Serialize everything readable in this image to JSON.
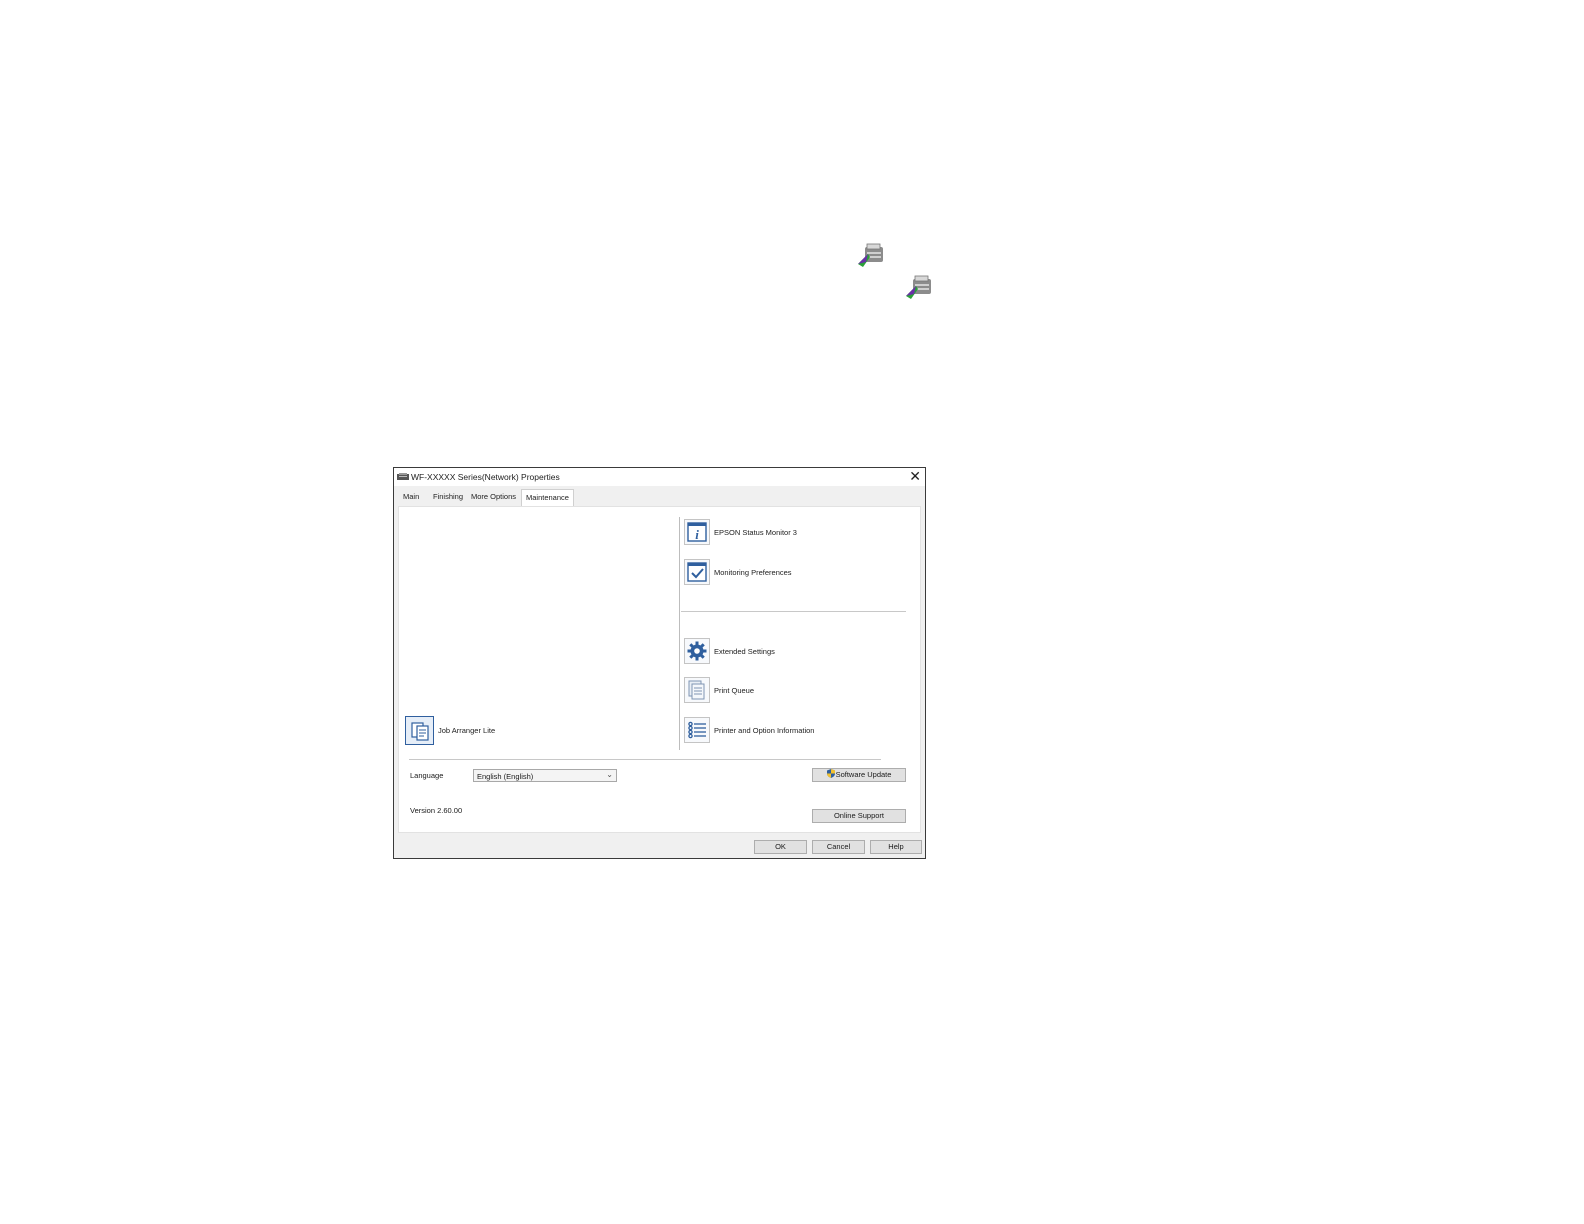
{
  "tray_icons": [
    {
      "name": "printer-driver-icon-1",
      "icon": "printer-arrow-icon"
    },
    {
      "name": "printer-driver-icon-2",
      "icon": "printer-arrow-icon"
    }
  ],
  "dialog": {
    "title": "WF-XXXXX Series(Network) Properties",
    "close_glyph": "✕",
    "tabs": [
      {
        "label": "Main",
        "active": false
      },
      {
        "label": "Finishing",
        "active": false
      },
      {
        "label": "More Options",
        "active": false
      },
      {
        "label": "Maintenance",
        "active": true
      }
    ],
    "left_tools": [
      {
        "label": "Job Arranger Lite",
        "icon": "job-arranger-icon"
      }
    ],
    "right_tools_top": [
      {
        "label": "EPSON Status Monitor 3",
        "icon": "info-icon"
      },
      {
        "label": "Monitoring Preferences",
        "icon": "checkmark-icon"
      }
    ],
    "right_tools_bottom": [
      {
        "label": "Extended Settings",
        "icon": "gear-icon"
      },
      {
        "label": "Print Queue",
        "icon": "print-queue-icon"
      },
      {
        "label": "Printer and Option Information",
        "icon": "list-icon"
      }
    ],
    "language": {
      "label": "Language",
      "selected": "English (English)"
    },
    "version": "Version 2.60.00",
    "software_update_label": "Software Update",
    "online_support_label": "Online Support",
    "footer": {
      "ok": "OK",
      "cancel": "Cancel",
      "help": "Help"
    }
  },
  "colors": {
    "accent": "#2f5f9e",
    "dialog_bg": "#f0f0f0",
    "button_bg": "#e1e1e1"
  }
}
